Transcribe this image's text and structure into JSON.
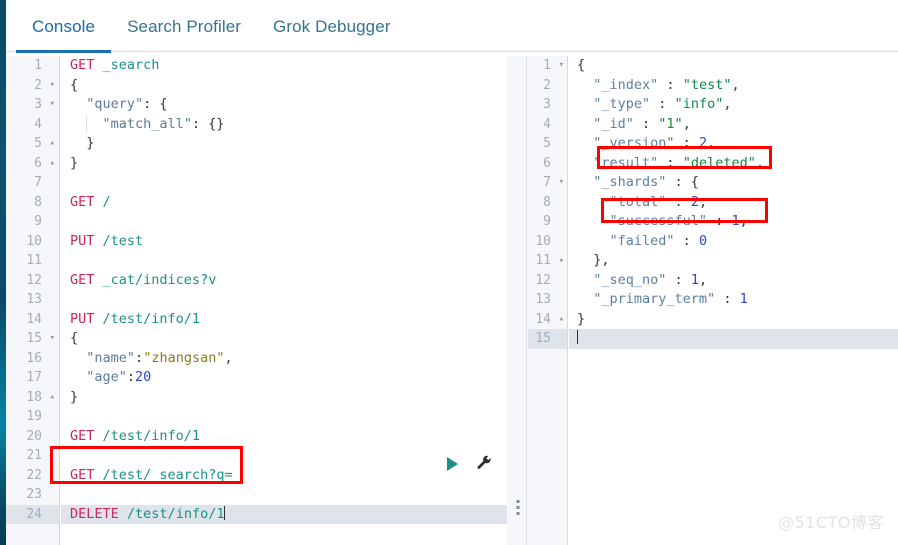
{
  "tabs": [
    {
      "label": "Console",
      "active": true
    },
    {
      "label": "Search Profiler",
      "active": false
    },
    {
      "label": "Grok Debugger",
      "active": false
    }
  ],
  "colors": {
    "accent_blue": "#1a6fb5",
    "tab_text": "#36738f",
    "method": "#c7275e",
    "url": "#1a9187",
    "request_key": "#5b7a99",
    "request_string": "#8a7b1e",
    "number": "#2a44d6",
    "response_key": "#5b7fa6",
    "response_string": "#12893f",
    "annotation_red": "#ff0000",
    "play_green": "#1a8f82",
    "active_line": "#dfe3ea",
    "gutter_bg": "#f5f7fa",
    "rail": "#0a4a63"
  },
  "request_editor": {
    "name": "console-request-editor",
    "active_line": 24,
    "cursor_line": 24,
    "lines": [
      {
        "n": 1,
        "fold": "",
        "text": "GET _search",
        "segments": [
          {
            "t": "GET",
            "c": "mth"
          },
          {
            "t": " ",
            "c": "punc"
          },
          {
            "t": "_search",
            "c": "url"
          }
        ]
      },
      {
        "n": 2,
        "fold": "▾",
        "text": "{",
        "segments": [
          {
            "t": "{",
            "c": "punc"
          }
        ]
      },
      {
        "n": 3,
        "fold": "▾",
        "text": "  \"query\": {",
        "segments": [
          {
            "t": "  ",
            "c": "punc"
          },
          {
            "t": "\"query\"",
            "c": "lkey"
          },
          {
            "t": ": {",
            "c": "punc"
          }
        ]
      },
      {
        "n": 4,
        "fold": "",
        "text": "    \"match_all\": {}",
        "segments": [
          {
            "t": "    ",
            "c": "punc"
          },
          {
            "t": "\"match_all\"",
            "c": "lkey"
          },
          {
            "t": ": {}",
            "c": "punc"
          }
        ]
      },
      {
        "n": 5,
        "fold": "▴",
        "text": "  }",
        "segments": [
          {
            "t": "  }",
            "c": "punc"
          }
        ]
      },
      {
        "n": 6,
        "fold": "▴",
        "text": "}",
        "segments": [
          {
            "t": "}",
            "c": "punc"
          }
        ]
      },
      {
        "n": 7,
        "fold": "",
        "text": "",
        "segments": []
      },
      {
        "n": 8,
        "fold": "",
        "text": "GET /",
        "segments": [
          {
            "t": "GET",
            "c": "mth"
          },
          {
            "t": " ",
            "c": "punc"
          },
          {
            "t": "/",
            "c": "url"
          }
        ]
      },
      {
        "n": 9,
        "fold": "",
        "text": "",
        "segments": []
      },
      {
        "n": 10,
        "fold": "",
        "text": "PUT /test",
        "segments": [
          {
            "t": "PUT",
            "c": "mth"
          },
          {
            "t": " ",
            "c": "punc"
          },
          {
            "t": "/test",
            "c": "url"
          }
        ]
      },
      {
        "n": 11,
        "fold": "",
        "text": "",
        "segments": []
      },
      {
        "n": 12,
        "fold": "",
        "text": "GET _cat/indices?v",
        "segments": [
          {
            "t": "GET",
            "c": "mth"
          },
          {
            "t": " ",
            "c": "punc"
          },
          {
            "t": "_cat/indices?v",
            "c": "url"
          }
        ]
      },
      {
        "n": 13,
        "fold": "",
        "text": "",
        "segments": []
      },
      {
        "n": 14,
        "fold": "",
        "text": "PUT /test/info/1",
        "segments": [
          {
            "t": "PUT",
            "c": "mth"
          },
          {
            "t": " ",
            "c": "punc"
          },
          {
            "t": "/test/info/1",
            "c": "url"
          }
        ]
      },
      {
        "n": 15,
        "fold": "▾",
        "text": "{",
        "segments": [
          {
            "t": "{",
            "c": "punc"
          }
        ]
      },
      {
        "n": 16,
        "fold": "",
        "text": "  \"name\":\"zhangsan\",",
        "segments": [
          {
            "t": "  ",
            "c": "punc"
          },
          {
            "t": "\"name\"",
            "c": "lkey"
          },
          {
            "t": ":",
            "c": "punc"
          },
          {
            "t": "\"zhangsan\"",
            "c": "lstr"
          },
          {
            "t": ",",
            "c": "punc"
          }
        ]
      },
      {
        "n": 17,
        "fold": "",
        "text": "  \"age\":20",
        "segments": [
          {
            "t": "  ",
            "c": "punc"
          },
          {
            "t": "\"age\"",
            "c": "lkey"
          },
          {
            "t": ":",
            "c": "punc"
          },
          {
            "t": "20",
            "c": "lnum"
          }
        ]
      },
      {
        "n": 18,
        "fold": "▴",
        "text": "}",
        "segments": [
          {
            "t": "}",
            "c": "punc"
          }
        ]
      },
      {
        "n": 19,
        "fold": "",
        "text": "",
        "segments": []
      },
      {
        "n": 20,
        "fold": "",
        "text": "GET /test/info/1",
        "segments": [
          {
            "t": "GET",
            "c": "mth"
          },
          {
            "t": " ",
            "c": "punc"
          },
          {
            "t": "/test/info/1",
            "c": "url"
          }
        ]
      },
      {
        "n": 21,
        "fold": "",
        "text": "",
        "segments": []
      },
      {
        "n": 22,
        "fold": "",
        "text": "GET /test/_search?q=",
        "segments": [
          {
            "t": "GET",
            "c": "mth"
          },
          {
            "t": " ",
            "c": "punc"
          },
          {
            "t": "/test/_search?q=",
            "c": "url"
          }
        ]
      },
      {
        "n": 23,
        "fold": "",
        "text": "",
        "segments": []
      },
      {
        "n": 24,
        "fold": "",
        "text": "DELETE /test/info/1",
        "segments": [
          {
            "t": "DELETE",
            "c": "mth"
          },
          {
            "t": " ",
            "c": "punc"
          },
          {
            "t": "/test/info/1",
            "c": "url"
          }
        ],
        "caret": true
      }
    ]
  },
  "response_editor": {
    "name": "console-response-viewer",
    "active_line": 15,
    "cursor_line": 15,
    "lines": [
      {
        "n": 1,
        "fold": "▾",
        "text": "{",
        "segments": [
          {
            "t": "{",
            "c": "rpunc"
          }
        ]
      },
      {
        "n": 2,
        "fold": "",
        "text": "  \"_index\" : \"test\",",
        "segments": [
          {
            "t": "  ",
            "c": "rpunc"
          },
          {
            "t": "\"_index\"",
            "c": "rkey"
          },
          {
            "t": " : ",
            "c": "rpunc"
          },
          {
            "t": "\"test\"",
            "c": "rstr"
          },
          {
            "t": ",",
            "c": "rpunc"
          }
        ]
      },
      {
        "n": 3,
        "fold": "",
        "text": "  \"_type\" : \"info\",",
        "segments": [
          {
            "t": "  ",
            "c": "rpunc"
          },
          {
            "t": "\"_type\"",
            "c": "rkey"
          },
          {
            "t": " : ",
            "c": "rpunc"
          },
          {
            "t": "\"info\"",
            "c": "rstr"
          },
          {
            "t": ",",
            "c": "rpunc"
          }
        ]
      },
      {
        "n": 4,
        "fold": "",
        "text": "  \"_id\" : \"1\",",
        "segments": [
          {
            "t": "  ",
            "c": "rpunc"
          },
          {
            "t": "\"_id\"",
            "c": "rkey"
          },
          {
            "t": " : ",
            "c": "rpunc"
          },
          {
            "t": "\"1\"",
            "c": "rstr"
          },
          {
            "t": ",",
            "c": "rpunc"
          }
        ]
      },
      {
        "n": 5,
        "fold": "",
        "text": "  \"_version\" : 2,",
        "segments": [
          {
            "t": "  ",
            "c": "rpunc"
          },
          {
            "t": "\"_version\"",
            "c": "rkey"
          },
          {
            "t": " : ",
            "c": "rpunc"
          },
          {
            "t": "2",
            "c": "rnum"
          },
          {
            "t": ",",
            "c": "rpunc"
          }
        ]
      },
      {
        "n": 6,
        "fold": "",
        "text": "  \"result\" : \"deleted\",",
        "segments": [
          {
            "t": "  ",
            "c": "rpunc"
          },
          {
            "t": "\"result\"",
            "c": "rkey"
          },
          {
            "t": " : ",
            "c": "rpunc"
          },
          {
            "t": "\"deleted\"",
            "c": "rstr"
          },
          {
            "t": ",",
            "c": "rpunc"
          }
        ]
      },
      {
        "n": 7,
        "fold": "▾",
        "text": "  \"_shards\" : {",
        "segments": [
          {
            "t": "  ",
            "c": "rpunc"
          },
          {
            "t": "\"_shards\"",
            "c": "rkey"
          },
          {
            "t": " : {",
            "c": "rpunc"
          }
        ]
      },
      {
        "n": 8,
        "fold": "",
        "text": "    \"total\" : 2,",
        "segments": [
          {
            "t": "    ",
            "c": "rpunc"
          },
          {
            "t": "\"total\"",
            "c": "rkey"
          },
          {
            "t": " : ",
            "c": "rpunc"
          },
          {
            "t": "2",
            "c": "rnum"
          },
          {
            "t": ",",
            "c": "rpunc"
          }
        ]
      },
      {
        "n": 9,
        "fold": "",
        "text": "    \"successful\" : 1,",
        "segments": [
          {
            "t": "    ",
            "c": "rpunc"
          },
          {
            "t": "\"successful\"",
            "c": "rkey"
          },
          {
            "t": " : ",
            "c": "rpunc"
          },
          {
            "t": "1",
            "c": "rnum"
          },
          {
            "t": ",",
            "c": "rpunc"
          }
        ]
      },
      {
        "n": 10,
        "fold": "",
        "text": "    \"failed\" : 0",
        "segments": [
          {
            "t": "    ",
            "c": "rpunc"
          },
          {
            "t": "\"failed\"",
            "c": "rkey"
          },
          {
            "t": " : ",
            "c": "rpunc"
          },
          {
            "t": "0",
            "c": "rnum"
          }
        ]
      },
      {
        "n": 11,
        "fold": "▴",
        "text": "  },",
        "segments": [
          {
            "t": "  },",
            "c": "rpunc"
          }
        ]
      },
      {
        "n": 12,
        "fold": "",
        "text": "  \"_seq_no\" : 1,",
        "segments": [
          {
            "t": "  ",
            "c": "rpunc"
          },
          {
            "t": "\"_seq_no\"",
            "c": "rkey"
          },
          {
            "t": " : ",
            "c": "rpunc"
          },
          {
            "t": "1",
            "c": "rnum"
          },
          {
            "t": ",",
            "c": "rpunc"
          }
        ]
      },
      {
        "n": 13,
        "fold": "",
        "text": "  \"_primary_term\" : 1",
        "segments": [
          {
            "t": "  ",
            "c": "rpunc"
          },
          {
            "t": "\"_primary_term\"",
            "c": "rkey"
          },
          {
            "t": " : ",
            "c": "rpunc"
          },
          {
            "t": "1",
            "c": "rnum"
          }
        ]
      },
      {
        "n": 14,
        "fold": "▴",
        "text": "}",
        "segments": [
          {
            "t": "}",
            "c": "rpunc"
          }
        ]
      },
      {
        "n": 15,
        "fold": "",
        "text": "",
        "segments": [],
        "caret": true
      }
    ]
  },
  "response_values": {
    "_index": "test",
    "_type": "info",
    "_id": "1",
    "_version": 2,
    "result": "deleted",
    "_shards": {
      "total": 2,
      "successful": 1,
      "failed": 0
    },
    "_seq_no": 1,
    "_primary_term": 1
  },
  "actions": {
    "play": {
      "name": "run-request-button",
      "glyph": "▶",
      "title": "Click to send request"
    },
    "wrench": {
      "name": "wrench-icon",
      "glyph": "wrench",
      "title": "Request options"
    }
  },
  "annotations": [
    {
      "name": "annotation-delete-request",
      "target": "DELETE /test/info/1"
    },
    {
      "name": "annotation-result-deleted",
      "target": "\"result\" : \"deleted\""
    },
    {
      "name": "annotation-successful",
      "target": "\"successful\" : 1"
    }
  ],
  "splitter": {
    "name": "pane-splitter",
    "handle": "drag-dots"
  },
  "watermark": {
    "text": "@51CTO博客"
  }
}
